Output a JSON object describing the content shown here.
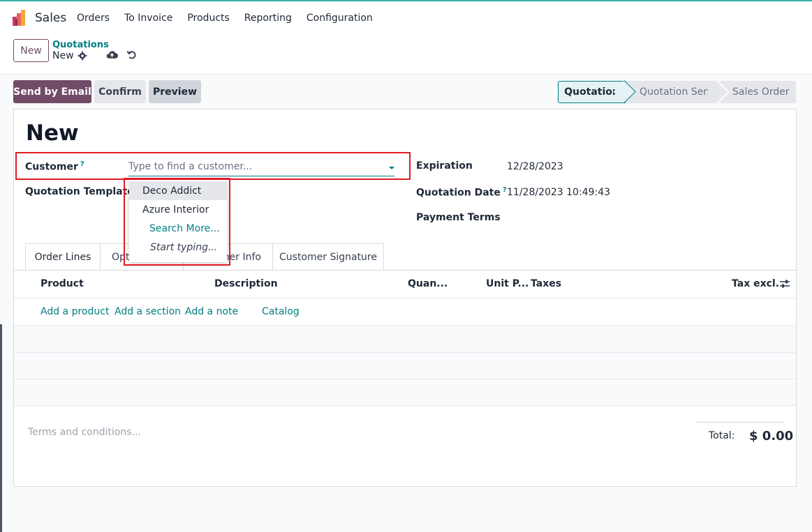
{
  "app": {
    "name": "Sales",
    "menu": [
      "Orders",
      "To Invoice",
      "Products",
      "Reporting",
      "Configuration"
    ]
  },
  "control": {
    "new_label": "New",
    "breadcrumb_parent": "Quotations",
    "breadcrumb_current": "New"
  },
  "actions": {
    "send_email": "Send by Email",
    "confirm": "Confirm",
    "preview": "Preview"
  },
  "status": {
    "stages": [
      "Quotation",
      "Quotation Sent",
      "Sales Order"
    ],
    "active": "Quotation"
  },
  "form": {
    "title": "New",
    "customer_label": "Customer",
    "help_mark": "?",
    "customer_placeholder": "Type to find a customer...",
    "template_label": "Quotation Template",
    "expiration_label": "Expiration",
    "expiration_value": "12/28/2023",
    "quotation_date_label": "Quotation Date",
    "quotation_date_value": "11/28/2023 10:49:43",
    "payment_terms_label": "Payment Terms"
  },
  "tabs": {
    "order_lines": "Order Lines",
    "optional": "Opt",
    "other_info": "her Info",
    "signature": "Customer Signature"
  },
  "table": {
    "headers": {
      "product": "Product",
      "description": "Description",
      "quantity": "Quan...",
      "unit_price": "Unit P...",
      "taxes": "Taxes",
      "tax_excl": "Tax excl."
    },
    "links": {
      "add_product": "Add a product",
      "add_section": "Add a section",
      "add_note": "Add a note",
      "catalog": "Catalog"
    }
  },
  "footer": {
    "terms_placeholder": "Terms and conditions...",
    "total_label": "Total:",
    "total_value": "$ 0.00"
  },
  "dropdown": {
    "items": [
      "Deco Addict",
      "Azure Interior"
    ],
    "search_more": "Search More...",
    "start_typing": "Start typing..."
  },
  "colors": {
    "brand": "#714b67",
    "accent": "#017e84",
    "highlight": "#e01b24"
  }
}
